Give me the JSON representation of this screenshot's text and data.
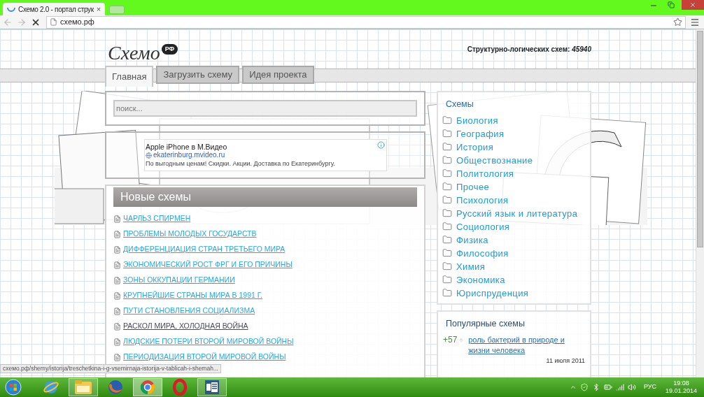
{
  "browser": {
    "tab_title": "Схемо 2.0 - портал струк",
    "tab_close": "×",
    "url": "схемо.рф"
  },
  "header": {
    "logo": {
      "text": "Схемо",
      "badge": "РФ"
    },
    "counter": {
      "label": "Структурно-логических схем:",
      "value": "45940"
    }
  },
  "nav": [
    {
      "label": "Главная",
      "selected": true
    },
    {
      "label": "Загрузить схему",
      "selected": false
    },
    {
      "label": "Идея проекта",
      "selected": false
    }
  ],
  "search": {
    "placeholder": "поиск..."
  },
  "ad": {
    "title": "Apple iPhone в М.Видео",
    "url": "ekaterinburg.mvideo.ru",
    "text": "По выгодным ценам! Скидки. Акции. Доставка по Екатеринбургу."
  },
  "new_schemes": {
    "title": "Новые схемы",
    "items": [
      {
        "label": "ЧАРЛЬЗ СПИРМЕН",
        "visited": false
      },
      {
        "label": "ПРОБЛЕМЫ МОЛОДЫХ ГОСУДАРСТВ",
        "visited": false
      },
      {
        "label": "ДИФФЕРЕНЦИАЦИЯ СТРАН ТРЕТЬЕГО МИРА",
        "visited": false
      },
      {
        "label": "ЭКОНОМИЧЕСКИЙ РОСТ ФРГ И ЕГО ПРИЧИНЫ",
        "visited": false
      },
      {
        "label": "ЗОНЫ ОККУПАЦИИ ГЕРМАНИИ",
        "visited": false
      },
      {
        "label": "КРУПНЕЙШИЕ СТРАНЫ МИРА В 1991 Г.",
        "visited": false
      },
      {
        "label": "ПУТИ СТАНОВЛЕНИЯ СОЦИАЛИЗМА",
        "visited": false
      },
      {
        "label": "РАСКОЛ МИРА, ХОЛОДНАЯ ВОЙНА",
        "visited": true
      },
      {
        "label": "ЛЮДСКИЕ ПОТЕРИ ВТОРОЙ МИРОВОЙ ВОЙНЫ",
        "visited": false
      },
      {
        "label": "ПЕРИОДИЗАЦИЯ ВТОРОЙ МИРОВОЙ ВОЙНЫ",
        "visited": false
      }
    ]
  },
  "categories": {
    "title": "Схемы",
    "items": [
      "Биология",
      "География",
      "История",
      "Обществознание",
      "Политология",
      "Прочее",
      "Психология",
      "Русский язык и литература",
      "Социология",
      "Физика",
      "Философия",
      "Химия",
      "Экономика",
      "Юриспруденция"
    ]
  },
  "popular": {
    "title": "Популярные схемы",
    "items": [
      {
        "score": "+57",
        "title": "роль бактерий в природе и жизни человека",
        "date": "11 июля 2011"
      }
    ]
  },
  "status_url": "схемо.рф/shemy/istorija/treschetkina-i-g-vsemirnaja-istorija-v-tablicah-i-shemah...",
  "taskbar": {
    "apps": [
      {
        "kind": "ie",
        "running": false,
        "selected": false
      },
      {
        "kind": "explorer",
        "running": true,
        "selected": false
      },
      {
        "kind": "firefox",
        "running": false,
        "selected": false
      },
      {
        "kind": "chrome",
        "running": true,
        "selected": true
      },
      {
        "kind": "opera",
        "running": false,
        "selected": false
      },
      {
        "kind": "word",
        "running": true,
        "selected": false
      }
    ],
    "language": "РУС",
    "time": "19:08",
    "date": "19.01.2014"
  }
}
